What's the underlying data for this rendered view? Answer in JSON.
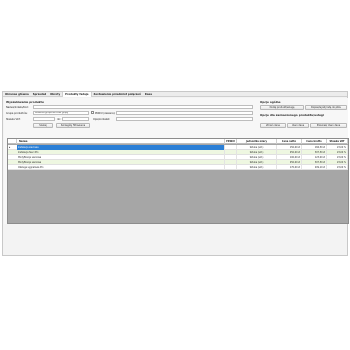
{
  "menu": [
    "Okrunas główna",
    "Sprzedaż",
    "Obroty",
    "Produkty fadaje",
    "Zestawienie przedmiot połączeń",
    "Kasa"
  ],
  "menu_active": 3,
  "form": {
    "title": "Wyszukiwanie produktu",
    "name_label": "Nazwa/Indeks/Kod:",
    "name_value": "",
    "group_label": "Grupa produktów:",
    "group_value": "Dowolna grupa lub brak grupy",
    "pkwiu_label": "PKWiU (zawiera):",
    "pkwiu_value": "",
    "vat_label": "Stawka VAT:",
    "vat_value": "",
    "vat2_label": "do:",
    "vat2_value": "",
    "desc_label": "Opis/kontekst:",
    "desc_value": "",
    "search_button": "Szukaj",
    "clear_button": "Szczegóły filtrowania"
  },
  "options": {
    "title": "Opcje ogólne",
    "button1": "Dodaj produkt/usługę",
    "button2": "Dopisz/wyślij listę do pliku",
    "subtitle": "Opcje dla zaznaczonego produktu/usługi",
    "edit_button": "Zmień dane",
    "delete_button": "Usuń dane",
    "extra_button": "Przenieś/ Usuń dane"
  },
  "table": {
    "headers": [
      "",
      "Nazwa",
      "PKWiU",
      "Jednostka miary",
      "Cena netto",
      "Cena brutto",
      "Stawka VAT"
    ],
    "rows": [
      {
        "marker": "▸",
        "name": "Instalacja sieciowe",
        "pkwiu": "",
        "unit": "Sztuka (szt.)",
        "net": "150,00 zł",
        "gross": "184,50 zł",
        "vat": "23,00 %",
        "selected": true
      },
      {
        "marker": "",
        "name": "Instalacja Sieci Pro",
        "pkwiu": "",
        "unit": "Sztuka (szt.)",
        "net": "250,00 zł",
        "gross": "307,50 zł",
        "vat": "23,00 %",
        "selected": false
      },
      {
        "marker": "",
        "name": "Modyfikacja sieciowa",
        "pkwiu": "",
        "unit": "Sztuka (szt.)",
        "net": "100,00 zł",
        "gross": "123,00 zł",
        "vat": "23,00 %",
        "selected": false
      },
      {
        "marker": "",
        "name": "Modyfikacja sieciowa",
        "pkwiu": "",
        "unit": "Sztuka (szt.)",
        "net": "250,00 zł",
        "gross": "307,50 zł",
        "vat": "23,00 %",
        "selected": false
      },
      {
        "marker": "",
        "name": "Obsługa sygnałowa Pro",
        "pkwiu": "",
        "unit": "Sztuka (szt.)",
        "net": "170,00 zł",
        "gross": "209,10 zł",
        "vat": "23,00 %",
        "selected": false
      }
    ]
  }
}
